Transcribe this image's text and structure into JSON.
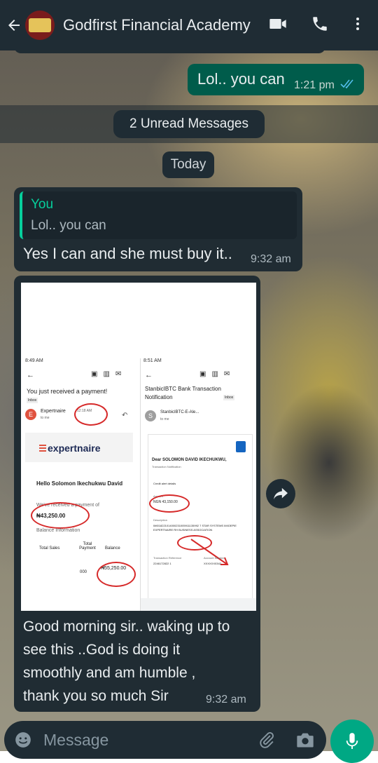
{
  "header": {
    "title": "Godfirst Financial Academy"
  },
  "messages": {
    "outgoing": {
      "text": "Lol.. you can",
      "time": "1:21 pm"
    },
    "unread_label": "2 Unread Messages",
    "date_label": "Today",
    "reply": {
      "quoted_author": "You",
      "quoted_text": "Lol.. you can",
      "text": "Yes I can and she must buy it..",
      "time": "9:32 am"
    },
    "image_message": {
      "caption": "Good morning sir.. waking up to see this ..God is doing it smoothly and am humble , thank you so much Sir",
      "time": "9:32 am",
      "left_screen": {
        "status_time": "8:49 AM",
        "subject": "You just received a payment!",
        "label": "Inbox",
        "sender": "Expertnaire",
        "sender_time": "12:18 AM",
        "to": "to me",
        "brand": "expertnaire",
        "greeting": "Hello Solomon Ikechukwu David",
        "received_text": "We've received a payment of",
        "amount": "₦43,250.00",
        "info_heading": "Balance Information",
        "col1": "Total Sales",
        "col2": "Total Payment",
        "col3": "Balance",
        "balance": "₦55,250.00",
        "sales_value": "000"
      },
      "right_screen": {
        "status_time": "8:51 AM",
        "subject": "StanbicIBTC Bank Transaction Notification",
        "label": "Inbox",
        "sender": "StanbicIBTC-E-Ale...",
        "sender_time": "8:51 AM",
        "to": "to me",
        "greeting": "Dear SOLOMON DAVID IKECHUKWU,",
        "sub": "Transaction Notification",
        "section": "Credit alert details",
        "amount_label": "Amount",
        "amount": "NGN 43,150.00",
        "desc_label": "Description",
        "desc": "IMI018221014000231005911135992 7 STAR SYSTEMS IMIOEPIE EXPERTNAIRE RH BUSINESS ASSOCIATION",
        "ref_label": "Transaction Reference",
        "acct_label": "Account Number",
        "ref": "2246172822 1",
        "acct": "XXXXXX0342"
      }
    }
  },
  "composer": {
    "placeholder": "Message"
  }
}
